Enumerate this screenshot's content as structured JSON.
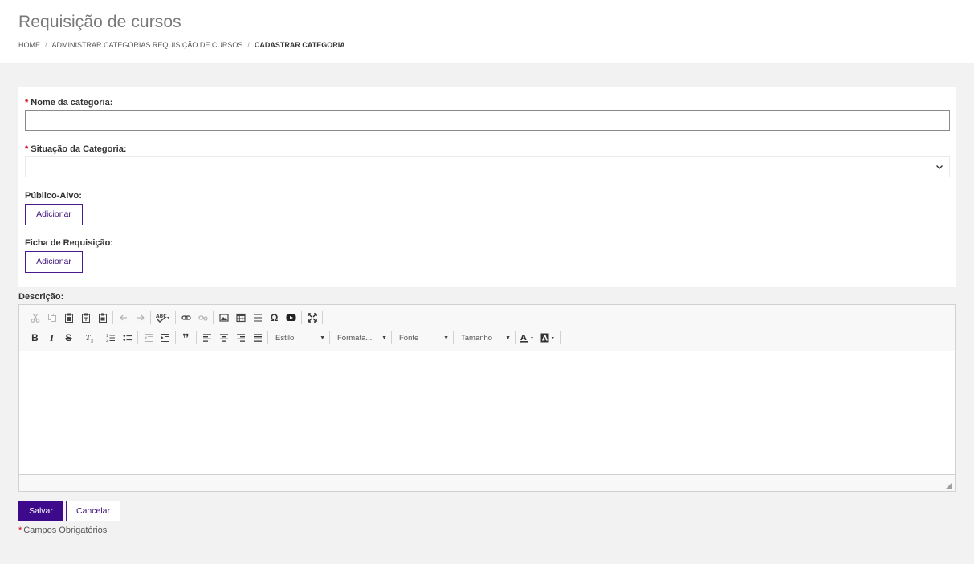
{
  "page": {
    "title": "Requisição de cursos"
  },
  "breadcrumb": {
    "items": [
      "HOME",
      "ADMINISTRAR CATEGORIAS REQUISIÇÃO DE CURSOS",
      "CADASTRAR CATEGORIA"
    ],
    "separator": "/"
  },
  "form": {
    "required_mark": "*",
    "category_name": {
      "label": "Nome da categoria:",
      "value": "",
      "placeholder": ""
    },
    "category_status": {
      "label": "Situação da Categoria:",
      "selected": ""
    },
    "target_audience": {
      "label": "Público-Alvo:",
      "button": "Adicionar"
    },
    "request_form": {
      "label": "Ficha de Requisição:",
      "button": "Adicionar"
    },
    "description": {
      "label": "Descrição:"
    }
  },
  "editor": {
    "toolbar_row1_icons": [
      "cut-icon",
      "copy-icon",
      "paste-icon",
      "paste-text-icon",
      "paste-word-icon",
      "undo-icon",
      "redo-icon",
      "spellcheck-icon",
      "link-icon",
      "unlink-icon",
      "image-icon",
      "table-icon",
      "horizontal-rule-icon",
      "special-char-icon",
      "youtube-icon",
      "maximize-icon"
    ],
    "toolbar_row2_icons": [
      "bold-icon",
      "italic-icon",
      "strike-icon",
      "remove-format-icon",
      "numbered-list-icon",
      "bulleted-list-icon",
      "outdent-icon",
      "indent-icon",
      "blockquote-icon",
      "align-left-icon",
      "align-center-icon",
      "align-right-icon",
      "justify-icon",
      "font-color-icon",
      "bg-color-icon"
    ],
    "combos": {
      "style": "Estilo",
      "format": "Formata...",
      "font": "Fonte",
      "size": "Tamanho"
    },
    "glyphs": {
      "bold": "B",
      "italic": "I",
      "strike": "S",
      "special_char": "Ω",
      "quote": "❞"
    }
  },
  "actions": {
    "save": "Salvar",
    "cancel": "Cancelar"
  },
  "footnote": {
    "mark": "*",
    "text": "Campos Obrigatórios"
  },
  "colors": {
    "primary": "#3c0a8a",
    "required": "#d0021b",
    "background": "#f2f2f2"
  }
}
